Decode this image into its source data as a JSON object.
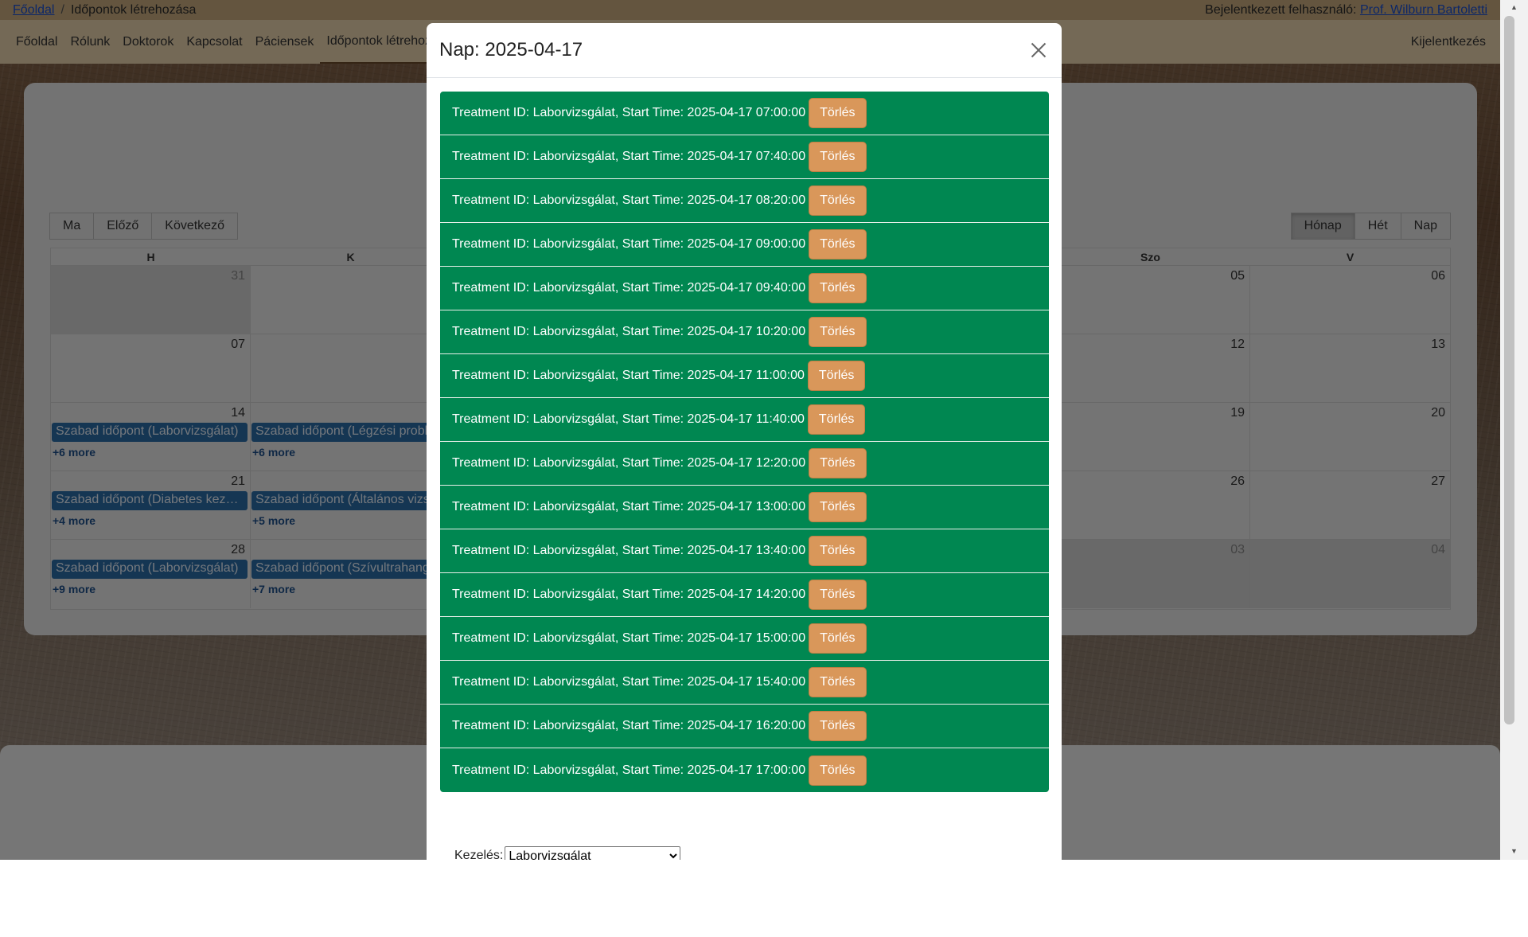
{
  "topbar": {
    "crumb_home": "Főoldal",
    "crumb_sep": "/",
    "crumb_current": "Időpontok létrehozása",
    "user_prefix": "Bejelentkezett felhasználó:",
    "user_name": "Prof. Wilburn Bartoletti"
  },
  "nav": {
    "items": [
      "Főoldal",
      "Rólunk",
      "Doktorok",
      "Kapcsolat",
      "Páciensek",
      "Időpontok létrehoz"
    ],
    "logout": "Kijelentkezés"
  },
  "calendar": {
    "toolbar_left": [
      "Ma",
      "Előző",
      "Következő"
    ],
    "toolbar_right": [
      "Hónap",
      "Hét",
      "Nap"
    ],
    "headers": [
      "H",
      "K",
      "Szo",
      "V"
    ],
    "days": {
      "r0": [
        "31",
        "05",
        "06"
      ],
      "r1": [
        "07",
        "12",
        "13"
      ],
      "r2": [
        "14",
        "19",
        "20"
      ],
      "r3": [
        "21",
        "26",
        "27"
      ],
      "r4": [
        "28",
        "03",
        "04"
      ]
    },
    "events": {
      "r2c0": "Szabad időpont (Laborvizsgálat)",
      "r2c1": "Szabad időpont (Légzési probl",
      "r3c0": "Szabad időpont (Diabetes kezel...",
      "r3c1": "Szabad időpont (Általános vizs",
      "r4c0": "Szabad időpont (Laborvizsgálat)",
      "r4c1": "Szabad időpont (Szívultrahang"
    },
    "more": {
      "r2c0": "+6 more",
      "r2c1": "+6 more",
      "r3c0": "+4 more",
      "r3c1": "+5 more",
      "r4c0": "+9 more",
      "r4c1": "+7 more"
    }
  },
  "modal": {
    "title": "Nap: 2025-04-17",
    "delete_label": "Törlés",
    "appointments": [
      "Treatment ID: Laborvizsgálat, Start Time: 2025-04-17 07:00:00",
      "Treatment ID: Laborvizsgálat, Start Time: 2025-04-17 07:40:00",
      "Treatment ID: Laborvizsgálat, Start Time: 2025-04-17 08:20:00",
      "Treatment ID: Laborvizsgálat, Start Time: 2025-04-17 09:00:00",
      "Treatment ID: Laborvizsgálat, Start Time: 2025-04-17 09:40:00",
      "Treatment ID: Laborvizsgálat, Start Time: 2025-04-17 10:20:00",
      "Treatment ID: Laborvizsgálat, Start Time: 2025-04-17 11:00:00",
      "Treatment ID: Laborvizsgálat, Start Time: 2025-04-17 11:40:00",
      "Treatment ID: Laborvizsgálat, Start Time: 2025-04-17 12:20:00",
      "Treatment ID: Laborvizsgálat, Start Time: 2025-04-17 13:00:00",
      "Treatment ID: Laborvizsgálat, Start Time: 2025-04-17 13:40:00",
      "Treatment ID: Laborvizsgálat, Start Time: 2025-04-17 14:20:00",
      "Treatment ID: Laborvizsgálat, Start Time: 2025-04-17 15:00:00",
      "Treatment ID: Laborvizsgálat, Start Time: 2025-04-17 15:40:00",
      "Treatment ID: Laborvizsgálat, Start Time: 2025-04-17 16:20:00",
      "Treatment ID: Laborvizsgálat, Start Time: 2025-04-17 17:00:00"
    ],
    "treatment_label": "Kezelés:",
    "treatment_selected": "Laborvizsgálat"
  },
  "colors": {
    "appointment_bg": "#008751",
    "delete_button": "#d9975a",
    "event_bg": "#2b6ca6",
    "topbar": "#c8ab7e",
    "navbar": "#e8d2ad"
  },
  "icons": {
    "close": "close-icon",
    "scroll_up": "scroll-up-arrow",
    "scroll_down": "scroll-down-arrow"
  }
}
